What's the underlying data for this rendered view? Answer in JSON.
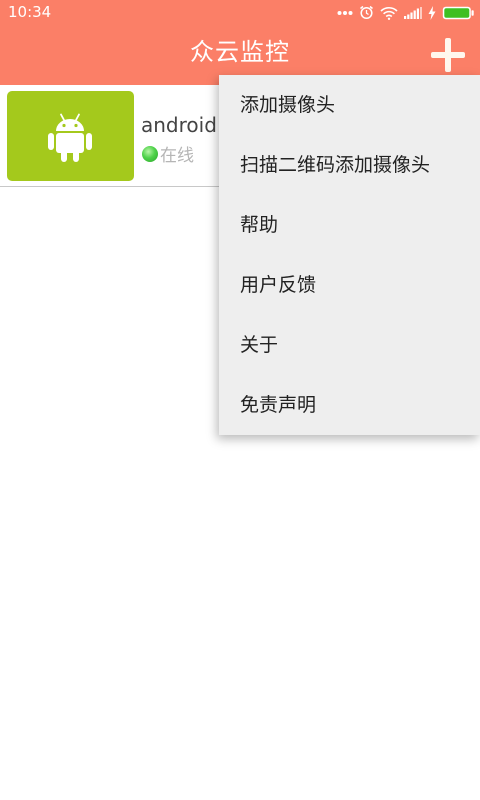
{
  "status_bar": {
    "time": "10:34",
    "icons": [
      "more-dots-icon",
      "alarm-icon",
      "wifi-icon",
      "signal-icon",
      "charging-icon",
      "battery-icon"
    ]
  },
  "app_bar": {
    "title": "众云监控",
    "add_icon": "plus-icon"
  },
  "device_list": [
    {
      "name": "android",
      "status": "在线",
      "thumbnail_icon": "android-robot-icon"
    }
  ],
  "menu": {
    "items": [
      {
        "label": "添加摄像头"
      },
      {
        "label": "扫描二维码添加摄像头"
      },
      {
        "label": "帮助"
      },
      {
        "label": "用户反馈"
      },
      {
        "label": "关于"
      },
      {
        "label": "免责声明"
      }
    ]
  },
  "colors": {
    "app_bar": "#fb7f67",
    "thumbnail_bg": "#a4c91c",
    "online_green": "#4fd24a",
    "battery_green": "#3fbf22",
    "menu_bg": "#eeeeee"
  }
}
